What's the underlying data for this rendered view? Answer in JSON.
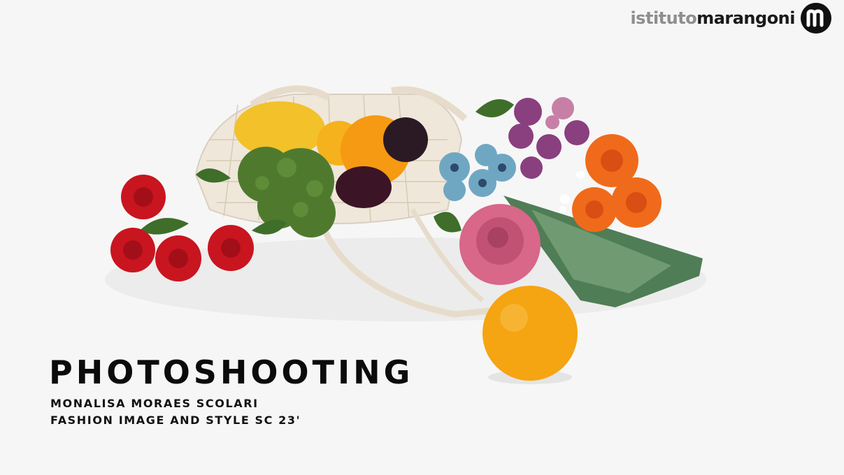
{
  "brand": {
    "name_light": "istituto",
    "name_dark": "marangoni",
    "mark_icon": "m-logo-icon"
  },
  "title": "PHOTOSHOOTING",
  "subtitle_lines": [
    "MONALISA MORAES SCOLARI",
    "FASHION IMAGE AND STYLE SC 23'"
  ],
  "colors": {
    "background": "#f6f6f6",
    "text": "#0b0b0b"
  }
}
